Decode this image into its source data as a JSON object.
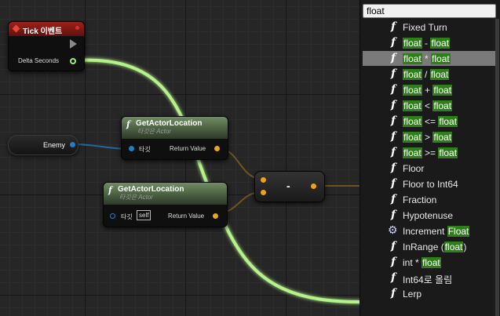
{
  "tick_node": {
    "title": "Tick 이벤트",
    "pin_delta": "Delta Seconds"
  },
  "enemy_node": {
    "label": "Enemy"
  },
  "get_loc_1": {
    "title": "GetActorLocation",
    "subtitle": "타깃은 Actor",
    "target_label": "타깃",
    "return_label": "Return Value"
  },
  "get_loc_2": {
    "title": "GetActorLocation",
    "subtitle": "타깃은 Actor",
    "target_label": "타깃",
    "self_value": "self",
    "return_label": "Return Value"
  },
  "subtract_node": {
    "op": "-"
  },
  "search": {
    "value": "float"
  },
  "menu_items": [
    {
      "icon": "function-icon",
      "pre": "Fixed Turn",
      "hl": "",
      "post": ""
    },
    {
      "icon": "function-icon",
      "pre": "",
      "hl": "float",
      "post": " - ",
      "hl2": "float"
    },
    {
      "icon": "function-icon",
      "pre": "",
      "hl": "float",
      "post": " * ",
      "hl2": "float",
      "selected": true
    },
    {
      "icon": "function-icon",
      "pre": "",
      "hl": "float",
      "post": " / ",
      "hl2": "float"
    },
    {
      "icon": "function-icon",
      "pre": "",
      "hl": "float",
      "post": " + ",
      "hl2": "float"
    },
    {
      "icon": "function-icon",
      "pre": "",
      "hl": "float",
      "post": " < ",
      "hl2": "float"
    },
    {
      "icon": "function-icon",
      "pre": "",
      "hl": "float",
      "post": " <= ",
      "hl2": "float"
    },
    {
      "icon": "function-icon",
      "pre": "",
      "hl": "float",
      "post": " > ",
      "hl2": "float"
    },
    {
      "icon": "function-icon",
      "pre": "",
      "hl": "float",
      "post": " >= ",
      "hl2": "float"
    },
    {
      "icon": "function-icon",
      "pre": "Floor",
      "hl": "",
      "post": ""
    },
    {
      "icon": "function-icon",
      "pre": "Floor to Int64",
      "hl": "",
      "post": ""
    },
    {
      "icon": "function-icon",
      "pre": "Fraction",
      "hl": "",
      "post": ""
    },
    {
      "icon": "function-icon",
      "pre": "Hypotenuse",
      "hl": "",
      "post": ""
    },
    {
      "icon": "gear-icon",
      "pre": "Increment ",
      "hl": "Float",
      "post": ""
    },
    {
      "icon": "function-icon",
      "pre": "InRange (",
      "hl": "float",
      "post": ")"
    },
    {
      "icon": "function-icon",
      "pre": "int * ",
      "hl": "float",
      "post": ""
    },
    {
      "icon": "function-icon",
      "pre": "Int64로 올림",
      "hl": "",
      "post": ""
    },
    {
      "icon": "function-icon",
      "pre": "Lerp",
      "hl": "",
      "post": ""
    }
  ],
  "colors": {
    "exec_red": "#8c1a14",
    "function_green": "#6f8d63",
    "wire_float": "#b5f28a",
    "wire_object": "#1f6a9b",
    "highlight": "#2f7e1b"
  }
}
